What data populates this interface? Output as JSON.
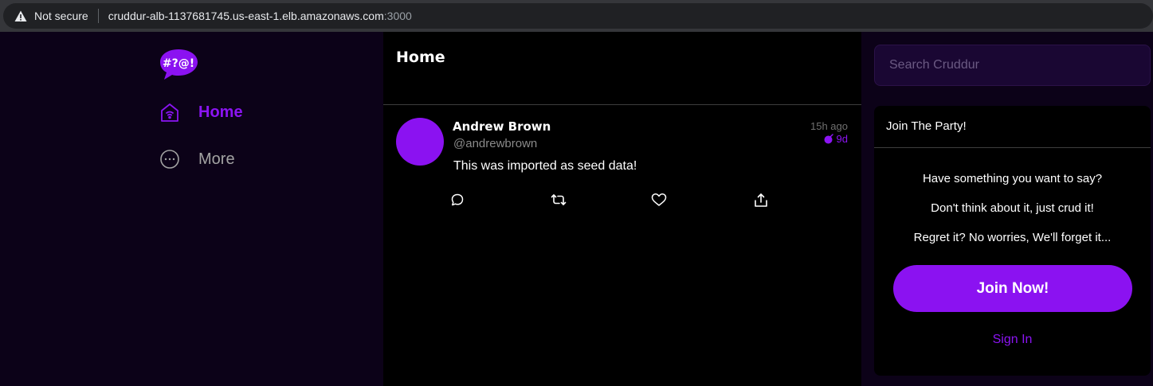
{
  "browser": {
    "security_label": "Not secure",
    "url_host": "cruddur-alb-1137681745.us-east-1.elb.amazonaws.com",
    "url_port": ":3000"
  },
  "nav": {
    "logo_text": "#?@!",
    "items": [
      {
        "label": "Home",
        "icon": "home-icon",
        "active": true
      },
      {
        "label": "More",
        "icon": "more-icon",
        "active": false
      }
    ]
  },
  "feed": {
    "title": "Home",
    "activities": [
      {
        "display_name": "Andrew Brown",
        "handle": "@andrewbrown",
        "created": "15h ago",
        "expires": "9d",
        "message": "This was imported as seed data!",
        "actions": [
          "reply-icon",
          "repost-icon",
          "like-icon",
          "share-icon"
        ]
      }
    ]
  },
  "sidebar": {
    "search_placeholder": "Search Cruddur",
    "join": {
      "title": "Join The Party!",
      "lines": [
        "Have something you want to say?",
        "Don't think about it, just crud it!",
        "Regret it? No worries, We'll forget it..."
      ],
      "button_label": "Join Now!",
      "sign_in_label": "Sign In"
    }
  },
  "colors": {
    "accent": "#8b14f2",
    "background": "#0c0218",
    "feed_background": "#000000",
    "search_background": "#1a0733"
  }
}
